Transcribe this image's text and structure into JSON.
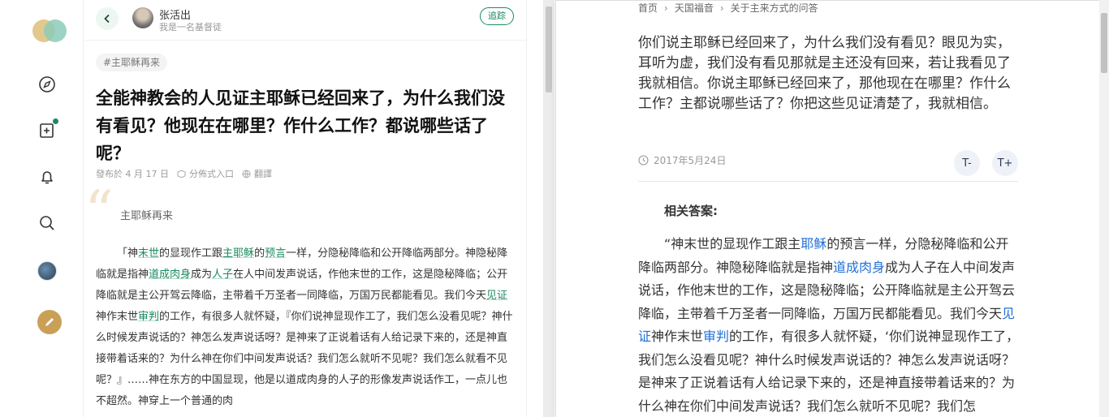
{
  "article": {
    "author_name": "张活出",
    "author_bio": "我是一名基督徒",
    "follow_label": "追踪",
    "tag": "#主耶稣再来",
    "title": "全能神教会的人见证主耶稣已经回来了，为什么我们没有看见？他现在在哪里？作什么工作？都说哪些话了呢？",
    "meta": {
      "published": "發布於 4 月 17 日",
      "source": "分佈式入口",
      "translate": "翻譯"
    },
    "quote": "主耶稣再来",
    "body": [
      {
        "t": "「神"
      },
      {
        "t": "末世",
        "link": true
      },
      {
        "t": "的显现作工跟"
      },
      {
        "t": "主耶稣",
        "link": true
      },
      {
        "t": "的"
      },
      {
        "t": "预言",
        "link": true
      },
      {
        "t": "一样，分隐秘降临和公开降临两部分。神隐秘降临就是指神"
      },
      {
        "t": "道成肉身",
        "link": true
      },
      {
        "t": "成为"
      },
      {
        "t": "人子",
        "link": true
      },
      {
        "t": "在人中间发声说话，作他末世的工作，这是隐秘降临；公开降临就是主公开驾云降临，主带着千万圣者一同降临，万国万民都能看见。我们今天"
      },
      {
        "t": "见证",
        "link": true
      },
      {
        "t": "神作末世"
      },
      {
        "t": "审判",
        "link": true
      },
      {
        "t": "的工作，有很多人就怀疑，『你们说神显现作工了，我们怎么没看见呢？神什么时候发声说话的？神怎么发声说话呀？是神来了正说着话有人给记录下来的，还是神直接带着话来的？为什么神在你们中间发声说话？我们怎么就听不见呢？我们怎么就看不见呢？』……神在东方的中国显现，他是以道成肉身的人子的形像发声说话作工，一点儿也不超然。神穿上一个普通的肉"
      }
    ]
  },
  "right": {
    "breadcrumb": [
      "首页",
      "天国福音",
      "关于主来方式的问答"
    ],
    "question": "你们说主耶稣已经回来了，为什么我们没有看见？眼见为实，耳听为虚，我们没有看见那就是主还没有回来，若让我看见了我就相信。你说主耶稣已经回来了，那他现在在哪里？作什么工作？主都说哪些话了？你把这些见证清楚了，我就相信。",
    "date": "2017年5月24日",
    "font_smaller": "T-",
    "font_larger": "T+",
    "related_label": "相关答案:",
    "answer": [
      {
        "t": "“神末世的显现作工跟主"
      },
      {
        "t": "耶稣",
        "link": true
      },
      {
        "t": "的预言一样，分隐秘降临和公开降临两部分。神隐秘降临就是指神"
      },
      {
        "t": "道成肉身",
        "link": true
      },
      {
        "t": "成为人子在人中间发声说话，作他末世的工作，这是隐秘降临；公开降临就是主公开驾云降临，主带着千万圣者一同降临，万国万民都能看见。我们今天"
      },
      {
        "t": "见证",
        "link": true
      },
      {
        "t": "神作末世"
      },
      {
        "t": "审判",
        "link": true
      },
      {
        "t": "的工作，有很多人就怀疑，‘你们说神显现作工了，我们怎么没看见呢？神什么时候发声说话的？神怎么发声说话呀？是神来了正说着话有人给记录下来的，还是神直接带着话来的？为什么神在你们中间发声说话？我们怎么就听不见呢？我们怎"
      }
    ]
  },
  "colors": {
    "accent_green": "#1a8a5e",
    "accent_blue": "#1f6fd6",
    "write_button": "#c9a056"
  },
  "icons": {
    "rail": [
      "compass-icon",
      "add-note-icon",
      "bell-icon",
      "search-icon",
      "user-avatar",
      "pencil-icon"
    ]
  }
}
